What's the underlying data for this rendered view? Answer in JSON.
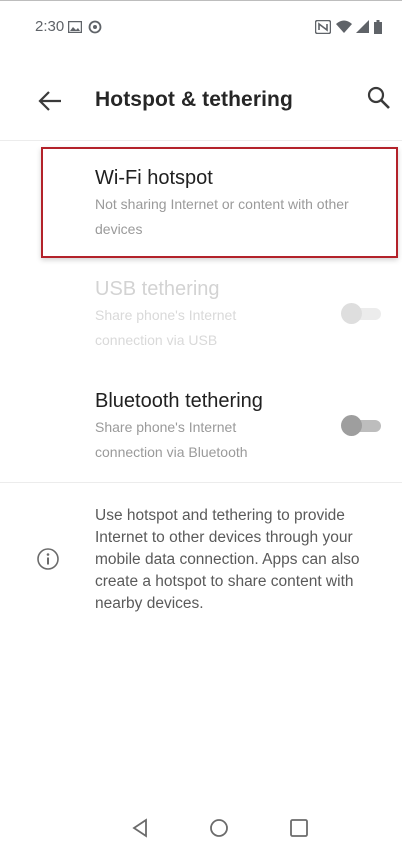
{
  "status_bar": {
    "time": "2:30",
    "left_icons": [
      "gallery-icon",
      "sync-icon"
    ],
    "right_icons": [
      "nfc-icon",
      "wifi-icon",
      "signal-icon",
      "battery-icon"
    ]
  },
  "app_bar": {
    "title": "Hotspot & tethering",
    "back_icon": "arrow-left-icon",
    "search_icon": "search-icon"
  },
  "items": [
    {
      "title": "Wi-Fi hotspot",
      "subtitle": "Not sharing Internet or content with other devices",
      "enabled": true,
      "highlighted": true
    },
    {
      "title": "USB tethering",
      "subtitle": "Share phone's Internet connection via USB",
      "enabled": false,
      "toggle_on": false
    },
    {
      "title": "Bluetooth tethering",
      "subtitle": "Share phone's Internet connection via Bluetooth",
      "enabled": true,
      "toggle_on": false
    }
  ],
  "info": {
    "icon": "info-icon",
    "text": "Use hotspot and tethering to provide Internet to other devices through your mobile data connection. Apps can also create a hotspot to share content with nearby devices."
  },
  "nav_bar": {
    "buttons": [
      "back-triangle-icon",
      "home-circle-icon",
      "recents-square-icon"
    ]
  },
  "colors": {
    "highlight_border": "#b3222a",
    "title_text": "#202020",
    "subtitle_text": "#9a9a9a",
    "disabled_text": "#d3d3d3"
  }
}
